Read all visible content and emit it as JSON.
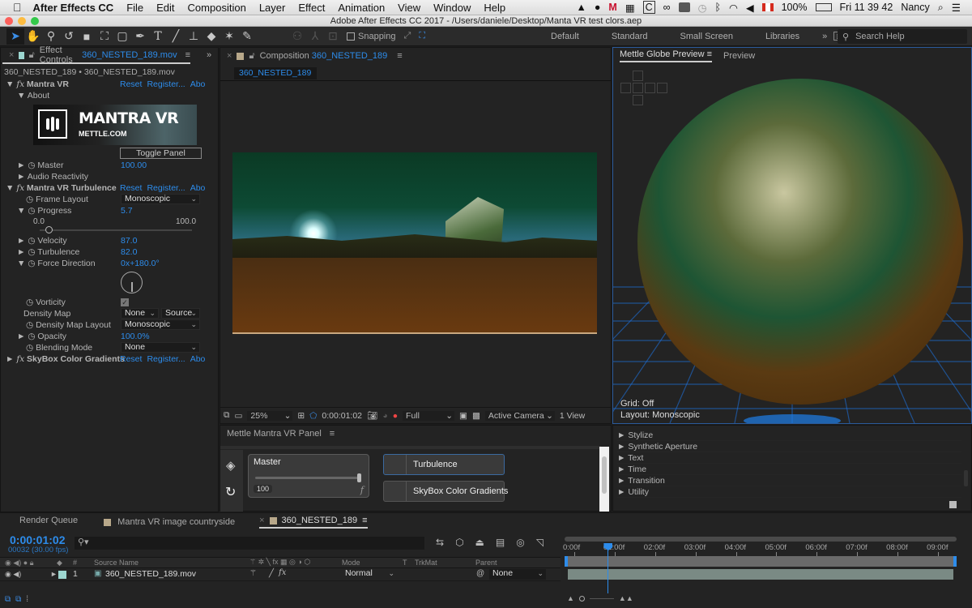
{
  "menubar": {
    "app_name": "After Effects CC",
    "items": [
      "File",
      "Edit",
      "Composition",
      "Layer",
      "Effect",
      "Animation",
      "View",
      "Window",
      "Help"
    ],
    "battery": "100%",
    "clock": "Fri 11 39 42",
    "user": "Nancy",
    "icons": [
      "drive-icon",
      "status-icon",
      "mcafee-icon",
      "film-icon",
      "c-icon",
      "creative-cloud-icon",
      "display-icon",
      "time-machine-icon",
      "bluetooth-icon",
      "wifi-icon",
      "volume-icon",
      "flag-canada-icon",
      "battery-icon",
      "spotlight-icon",
      "notification-icon"
    ]
  },
  "titlebar": {
    "title": "Adobe After Effects CC 2017 - /Users/daniele/Desktop/Manta VR test clors.aep"
  },
  "toolbar": {
    "tools": [
      "selection-tool",
      "hand-tool",
      "zoom-tool",
      "rotate-tool",
      "camera-tool",
      "pan-behind-tool",
      "rectangle-tool",
      "pen-tool",
      "type-tool",
      "brush-tool",
      "clone-stamp-tool",
      "eraser-tool",
      "roto-brush-tool",
      "puppet-pin-tool"
    ],
    "snapping_label": "Snapping",
    "snapping_checked": false,
    "workspaces": [
      "Default",
      "Standard",
      "Small Screen",
      "Libraries"
    ],
    "overflow": "»",
    "search_placeholder": "Search Help"
  },
  "effect_controls": {
    "tab_label": "Effect Controls",
    "tab_file": "360_NESTED_189.mov",
    "breadcrumb": "360_NESTED_189 • 360_NESTED_189.mov",
    "links": {
      "reset": "Reset",
      "register": "Register...",
      "about": "Abo"
    },
    "effect1": {
      "name": "Mantra VR",
      "about": "About",
      "banner_title": "MANTRA VR",
      "banner_sub": "METTLE.COM",
      "toggle_panel": "Toggle Panel",
      "master_label": "Master",
      "master_value": "100.00",
      "audio_reactivity": "Audio Reactivity"
    },
    "effect2": {
      "name": "Mantra VR Turbulence",
      "frame_layout_label": "Frame Layout",
      "frame_layout_value": "Monoscopic",
      "progress_label": "Progress",
      "progress_value": "5.7",
      "progress_min": "0.0",
      "progress_max": "100.0",
      "progress_fraction": 0.057,
      "velocity_label": "Velocity",
      "velocity_value": "87.0",
      "turbulence_label": "Turbulence",
      "turbulence_value": "82.0",
      "force_direction_label": "Force Direction",
      "force_direction_value": "0x+180.0°",
      "vorticity_label": "Vorticity",
      "vorticity_checked": true,
      "density_map_label": "Density Map",
      "density_map_value": "None",
      "density_map_source": "Source",
      "density_map_layout_label": "Density Map Layout",
      "density_map_layout_value": "Monoscopic",
      "opacity_label": "Opacity",
      "opacity_value": "100.0%",
      "blending_mode_label": "Blending Mode",
      "blending_mode_value": "None"
    },
    "effect3": {
      "name": "SkyBox Color Gradients"
    }
  },
  "composition": {
    "tab_label": "Composition",
    "tab_name": "360_NESTED_189",
    "subtab": "360_NESTED_189",
    "footer": {
      "zoom": "25%",
      "timecode": "0:00:01:02",
      "resolution": "Full",
      "camera": "Active Camera",
      "views": "1 View"
    }
  },
  "mantra_panel": {
    "title": "Mettle Mantra VR Panel",
    "master_label": "Master",
    "master_value": "100",
    "master_fraction": 1.0,
    "fx_glyph": "f",
    "effects": [
      "Turbulence",
      "SkyBox Color Gradients"
    ]
  },
  "globe_preview": {
    "tab_label": "Mettle Globe Preview",
    "tab2_label": "Preview",
    "grid_status": "Grid: Off",
    "layout_status": "Layout: Monoscopic"
  },
  "effects_presets": {
    "items": [
      "Stylize",
      "Synthetic Aperture",
      "Text",
      "Time",
      "Transition",
      "Utility"
    ]
  },
  "timeline": {
    "tabs": [
      {
        "label": "Render Queue",
        "color": null
      },
      {
        "label": "Mantra VR image countryside",
        "color": "#b8a88a"
      },
      {
        "label": "360_NESTED_189",
        "color": "#b8a88a",
        "active": true
      }
    ],
    "timecode": "0:00:01:02",
    "frame_info": "00032 (30.00 fps)",
    "search_placeholder": "",
    "columns": {
      "hash": "#",
      "source_name": "Source Name",
      "mode": "Mode",
      "t": "T",
      "trkmat": "TrkMat",
      "parent": "Parent"
    },
    "layers": [
      {
        "index": "1",
        "name": "360_NESTED_189.mov",
        "mode": "Normal",
        "parent": "None",
        "label_color": "#9cd6d0"
      }
    ],
    "ruler": [
      "0:00f",
      "01:00f",
      "02:00f",
      "03:00f",
      "04:00f",
      "05:00f",
      "06:00f",
      "07:00f",
      "08:00f",
      "09:00f"
    ],
    "playhead_seconds": 1.07,
    "duration_seconds": 9.7
  },
  "colors": {
    "accent": "#2d8ceb",
    "panel_bg": "#232323",
    "grid_blue": "#1e6fd9"
  }
}
